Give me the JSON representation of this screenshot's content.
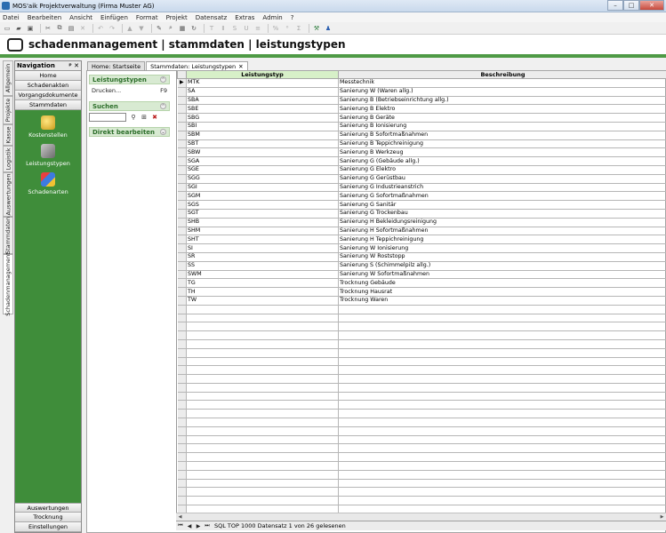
{
  "window": {
    "title": "MOS'aik Projektverwaltung (Firma Muster AG)",
    "min": "–",
    "max": "□",
    "close": "✕"
  },
  "menu": [
    "Datei",
    "Bearbeiten",
    "Ansicht",
    "Einfügen",
    "Format",
    "Projekt",
    "Datensatz",
    "Extras",
    "Admin",
    "?"
  ],
  "header": {
    "title": "schadenmanagement | stammdaten | leistungstypen"
  },
  "vtabs": [
    "Allgemein",
    "Projekte",
    "Kasse",
    "Logistik",
    "Auswertungen",
    "Stammdaten",
    "Schadenmanagement"
  ],
  "nav": {
    "title": "Navigation",
    "pin": "ᵖ",
    "close": "✕",
    "top_buttons": [
      "Home",
      "Schadenakten",
      "Vorgangsdokumente",
      "Stammdaten"
    ],
    "items": [
      "Kostenstellen",
      "Leistungstypen",
      "Schadenarten"
    ],
    "bottom_buttons": [
      "Auswertungen",
      "Trocknung",
      "Einstellungen"
    ]
  },
  "tabs": [
    {
      "label": "Home: Startseite"
    },
    {
      "label": "Stammdaten: Leistungstypen",
      "close": "✕"
    }
  ],
  "panel": {
    "leistungstypen": {
      "title": "Leistungstypen",
      "print_label": "Drucken...",
      "print_key": "F9"
    },
    "suchen": {
      "title": "Suchen",
      "placeholder": ""
    },
    "direkt": {
      "title": "Direkt bearbeiten"
    }
  },
  "grid": {
    "columns": [
      "Leistungstyp",
      "Beschreibung"
    ],
    "rows": [
      [
        "MTK",
        "Messtechnik"
      ],
      [
        "SA",
        "Sanierung W (Waren allg.)"
      ],
      [
        "SBA",
        "Sanierung B (Betriebseinrichtung allg.)"
      ],
      [
        "SBE",
        "Sanierung B Elektro"
      ],
      [
        "SBG",
        "Sanierung B Geräte"
      ],
      [
        "SBI",
        "Sanierung B Ionisierung"
      ],
      [
        "SBM",
        "Sanierung B Sofortmaßnahmen"
      ],
      [
        "SBT",
        "Sanierung B Teppichreinigung"
      ],
      [
        "SBW",
        "Sanierung B Werkzeug"
      ],
      [
        "SGA",
        "Sanierung G (Gebäude allg.)"
      ],
      [
        "SGE",
        "Sanierung G Elektro"
      ],
      [
        "SGG",
        "Sanierung G Gerüstbau"
      ],
      [
        "SGI",
        "Sanierung G Industrieanstrich"
      ],
      [
        "SGM",
        "Sanierung G Sofortmaßnahmen"
      ],
      [
        "SGS",
        "Sanierung G Sanitär"
      ],
      [
        "SGT",
        "Sanierung G Trockenbau"
      ],
      [
        "SHB",
        "Sanierung H Bekleidungsreinigung"
      ],
      [
        "SHM",
        "Sanierung H Sofortmaßnahmen"
      ],
      [
        "SHT",
        "Sanierung H Teppichreinigung"
      ],
      [
        "SI",
        "Sanierung W Ionisierung"
      ],
      [
        "SR",
        "Sanierung W Roststopp"
      ],
      [
        "SS",
        "Sanierung S (Schimmelpilz allg.)"
      ],
      [
        "SWM",
        "Sanierung W Sofortmaßnahmen"
      ],
      [
        "TG",
        "Trocknung Gebäude"
      ],
      [
        "TH",
        "Trocknung Hausrat"
      ],
      [
        "TW",
        "Trocknung Waren"
      ]
    ],
    "current_row_marker": "▶",
    "status": "SQL TOP 1000 Datensatz 1 von 26 gelesenen"
  },
  "colors": {
    "accent_green": "#4e9a45",
    "nav_green": "#3f8d3a",
    "panel_header": "#d8ead2",
    "grid_header_selected": "#d7f0c8"
  }
}
